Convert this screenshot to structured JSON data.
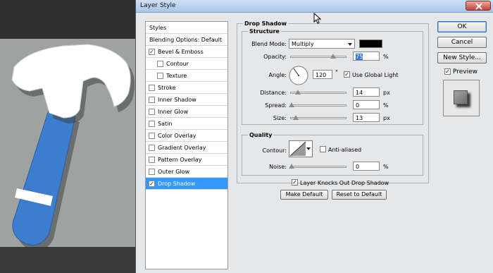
{
  "colors": {
    "shadow_color": "#000000",
    "selection": "#3399ff",
    "handle_blue": "#3d7dd0"
  },
  "dialog": {
    "title": "Layer Style"
  },
  "styles_panel": {
    "header": "Styles",
    "items": [
      {
        "label": "Blending Options: Default",
        "checkbox": false
      },
      {
        "label": "Bevel & Emboss",
        "checkbox": true,
        "checked": true
      },
      {
        "label": "Contour",
        "checkbox": true,
        "checked": false,
        "sub": true
      },
      {
        "label": "Texture",
        "checkbox": true,
        "checked": false,
        "sub": true
      },
      {
        "label": "Stroke",
        "checkbox": true,
        "checked": false
      },
      {
        "label": "Inner Shadow",
        "checkbox": true,
        "checked": false
      },
      {
        "label": "Inner Glow",
        "checkbox": true,
        "checked": false
      },
      {
        "label": "Satin",
        "checkbox": true,
        "checked": false
      },
      {
        "label": "Color Overlay",
        "checkbox": true,
        "checked": false
      },
      {
        "label": "Gradient Overlay",
        "checkbox": true,
        "checked": false
      },
      {
        "label": "Pattern Overlay",
        "checkbox": true,
        "checked": false
      },
      {
        "label": "Outer Glow",
        "checkbox": true,
        "checked": false
      },
      {
        "label": "Drop Shadow",
        "checkbox": true,
        "checked": true,
        "selected": true
      }
    ]
  },
  "drop_shadow": {
    "title": "Drop Shadow",
    "structure": {
      "title": "Structure",
      "blend_mode_label": "Blend Mode:",
      "blend_mode_value": "Multiply",
      "opacity_label": "Opacity:",
      "opacity_value": "75",
      "opacity_unit": "%",
      "angle_label": "Angle:",
      "angle_value": "120",
      "angle_unit": "°",
      "use_global_light_label": "Use Global Light",
      "use_global_light_checked": true,
      "distance_label": "Distance:",
      "distance_value": "14",
      "distance_unit": "px",
      "spread_label": "Spread:",
      "spread_value": "0",
      "spread_unit": "%",
      "size_label": "Size:",
      "size_value": "13",
      "size_unit": "px"
    },
    "quality": {
      "title": "Quality",
      "contour_label": "Contour:",
      "anti_aliased_label": "Anti-aliased",
      "anti_aliased_checked": false,
      "noise_label": "Noise:",
      "noise_value": "0",
      "noise_unit": "%"
    },
    "knockout_label": "Layer Knocks Out Drop Shadow",
    "knockout_checked": true,
    "make_default_label": "Make Default",
    "reset_default_label": "Reset to Default"
  },
  "buttons": {
    "ok_label": "OK",
    "cancel_label": "Cancel",
    "new_style_label": "New Style...",
    "preview_label": "Preview",
    "preview_checked": true
  }
}
